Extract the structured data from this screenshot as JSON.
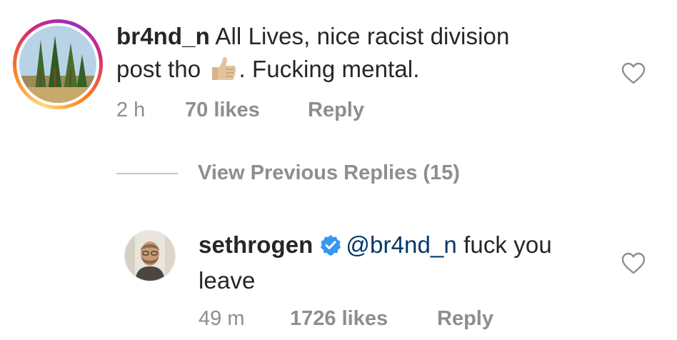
{
  "comment1": {
    "username": "br4nd_n",
    "text_line1": "All Lives, nice racist division",
    "text_line2_before": "post tho",
    "emoji": "thumbs-up-icon",
    "text_line2_after": ". Fucking mental.",
    "time": "2 h",
    "likes": "70 likes",
    "reply": "Reply"
  },
  "view_previous": "View Previous Replies (15)",
  "comment2": {
    "username": "sethrogen",
    "mention": "@br4nd_n",
    "text_after_mention": " fuck you",
    "text_line2": "leave",
    "time": "49 m",
    "likes": "1726 likes",
    "reply": "Reply"
  },
  "colors": {
    "mention": "#00376b",
    "verified": "#3897f0",
    "meta": "#8e8e8e"
  }
}
